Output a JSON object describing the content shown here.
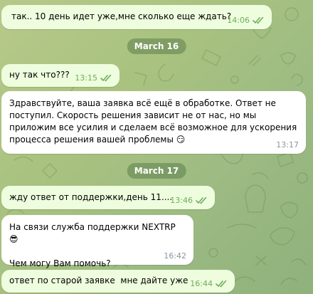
{
  "dates": {
    "march16": "March 16",
    "march17": "March 17"
  },
  "messages": [
    {
      "text": "так.. 10 день идет уже,мне сколько еще ждать?",
      "time": "14:06",
      "direction": "out",
      "status": "read"
    },
    {
      "text": "ну так что???",
      "time": "13:15",
      "direction": "out",
      "status": "read"
    },
    {
      "text": "Здравствуйте, ваша заявка всё ещё в обработке. Ответ не поступил. Скорость решения зависит не от нас, но мы приложим все усилия и сделаем всё возможное для ускорения процесса решения вашей проблемы 😏",
      "time": "13:17",
      "direction": "in"
    },
    {
      "text": "жду ответ от поддержки,день 11....",
      "time": "13:46",
      "direction": "out",
      "status": "read"
    },
    {
      "text": "На связи служба поддержки NEXTRP 😎\n\nЧем могу Вам помочь?",
      "time": "16:42",
      "direction": "in"
    },
    {
      "text": "ответ по старой заявке  мне дайте уже",
      "time": "16:44",
      "direction": "out",
      "status": "read"
    }
  ],
  "colors": {
    "outgoing_bubble": "#eefdde",
    "incoming_bubble": "#ffffff",
    "read_check": "#6fad5d",
    "timestamp_in": "#8a95a2",
    "date_pill": "#5c804c"
  },
  "icons": {
    "read_status": "double-check-icon"
  }
}
